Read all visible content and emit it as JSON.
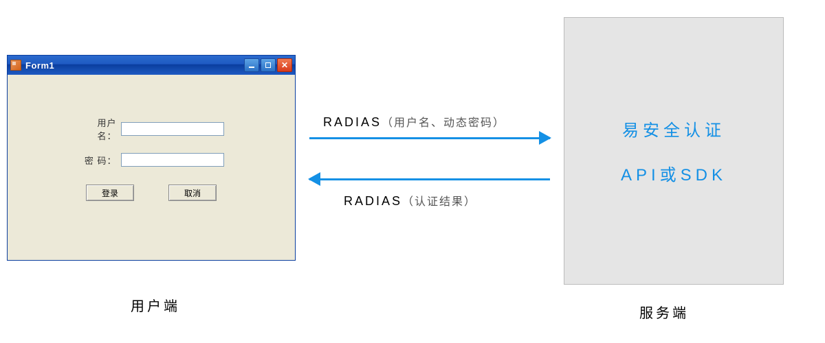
{
  "client": {
    "window_title": "Form1",
    "fields": {
      "username_label": "用户名：",
      "password_label": "密 码："
    },
    "buttons": {
      "login": "登录",
      "cancel": "取消"
    },
    "caption": "用户端"
  },
  "arrows": {
    "request_protocol": "RADIAS",
    "request_payload": "（用户名、动态密码）",
    "response_protocol": "RADIAS",
    "response_payload": "（认证结果）"
  },
  "server": {
    "line1": "易安全认证",
    "line2": "API或SDK",
    "caption": "服务端"
  }
}
